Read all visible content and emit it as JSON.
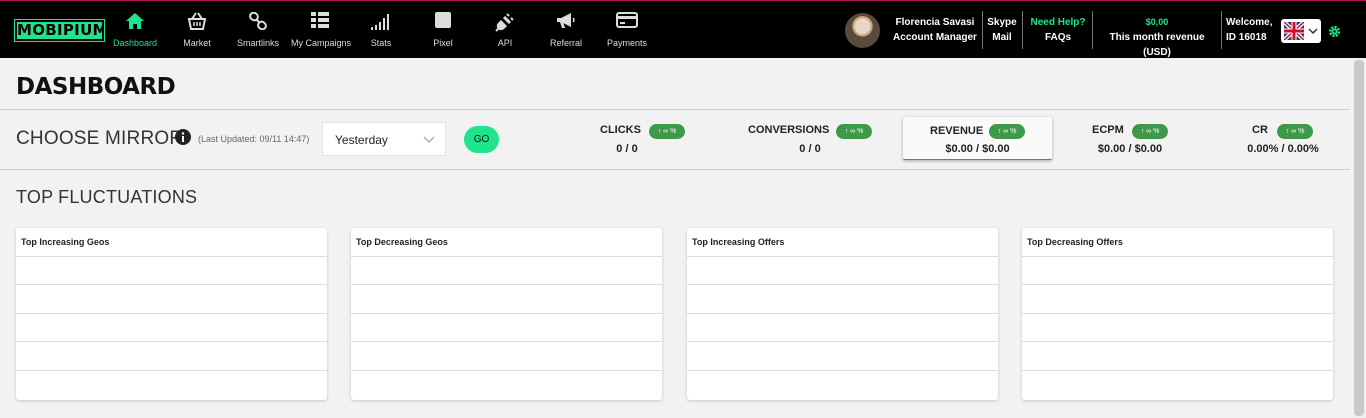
{
  "brand": {
    "logo_text": "MOBIPIUM",
    "accent": "#1ee58c"
  },
  "nav": [
    {
      "label": "Dashboard",
      "icon": "home-icon",
      "active": true
    },
    {
      "label": "Market",
      "icon": "basket-icon"
    },
    {
      "label": "Smartlinks",
      "icon": "link-icon"
    },
    {
      "label": "My Campaigns",
      "icon": "grid-list-icon"
    },
    {
      "label": "Stats",
      "icon": "signal-bars-icon"
    },
    {
      "label": "Pixel",
      "icon": "square-icon"
    },
    {
      "label": "API",
      "icon": "plug-icon"
    },
    {
      "label": "Referral",
      "icon": "megaphone-icon"
    },
    {
      "label": "Payments",
      "icon": "credit-card-icon"
    }
  ],
  "manager": {
    "name": "Florencia Savasi",
    "role": "Account Manager"
  },
  "contact": {
    "line1": "Skype",
    "line2": "Mail"
  },
  "help": {
    "line1": "Need Help?",
    "line2": "FAQs"
  },
  "revenue_header": {
    "amount": "$0,00",
    "label": "This month revenue (USD)"
  },
  "welcome": {
    "line1": "Welcome,",
    "line2": "ID 16018"
  },
  "page": {
    "title": "DASHBOARD"
  },
  "mirror": {
    "label": "CHOOSE MIRROR",
    "last_updated": "(Last Updated: 09/11 14:47)",
    "selected": "Yesterday",
    "go_label": "GO"
  },
  "stats": [
    {
      "name": "CLICKS",
      "badge": "↑ ∞ %",
      "value": "0 / 0"
    },
    {
      "name": "CONVERSIONS",
      "badge": "↑ ∞ %",
      "value": "0 / 0"
    },
    {
      "name": "REVENUE",
      "badge": "↑ ∞ %",
      "value": "$0.00 / $0.00"
    },
    {
      "name": "ECPM",
      "badge": "↑ ∞ %",
      "value": "$0.00 / $0.00"
    },
    {
      "name": "CR",
      "badge": "↑ ∞ %",
      "value": "0.00% / 0.00%"
    }
  ],
  "fluctuations": {
    "title": "TOP FLUCTUATIONS",
    "panels": [
      {
        "title": "Top Increasing Geos"
      },
      {
        "title": "Top Decreasing Geos"
      },
      {
        "title": "Top Increasing Offers"
      },
      {
        "title": "Top Decreasing Offers"
      }
    ]
  }
}
